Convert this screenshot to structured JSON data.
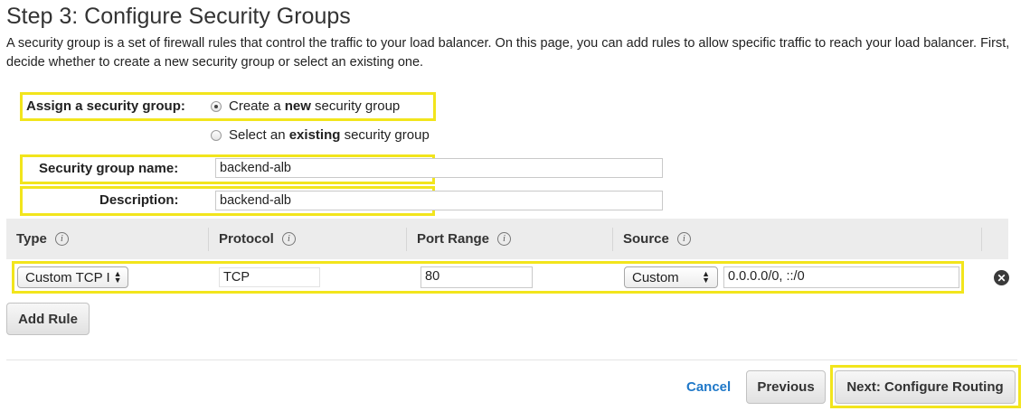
{
  "header": {
    "title": "Step 3: Configure Security Groups",
    "description": "A security group is a set of firewall rules that control the traffic to your load balancer. On this page, you can add rules to allow specific traffic to reach your load balancer. First, decide whether to create a new security group or select an existing one."
  },
  "assign": {
    "label": "Assign a security group:",
    "option_new": {
      "pre": "Create a ",
      "bold": "new",
      "post": " security group",
      "selected": true
    },
    "option_existing": {
      "pre": "Select an ",
      "bold": "existing",
      "post": " security group",
      "selected": false
    }
  },
  "form": {
    "name_label": "Security group name:",
    "name_value": "backend-alb",
    "description_label": "Description:",
    "description_value": "backend-alb"
  },
  "table": {
    "columns": [
      "Type",
      "Protocol",
      "Port Range",
      "Source"
    ],
    "row": {
      "type": "Custom TCP I",
      "protocol": "TCP",
      "port_range": "80",
      "source_select": "Custom",
      "source_value": "0.0.0.0/0, ::/0"
    }
  },
  "buttons": {
    "add_rule": "Add Rule",
    "cancel": "Cancel",
    "previous": "Previous",
    "next": "Next: Configure Routing"
  },
  "colors": {
    "highlight": "#f2e51c",
    "link": "#1f78c8",
    "table_header_bg": "#ececec"
  }
}
